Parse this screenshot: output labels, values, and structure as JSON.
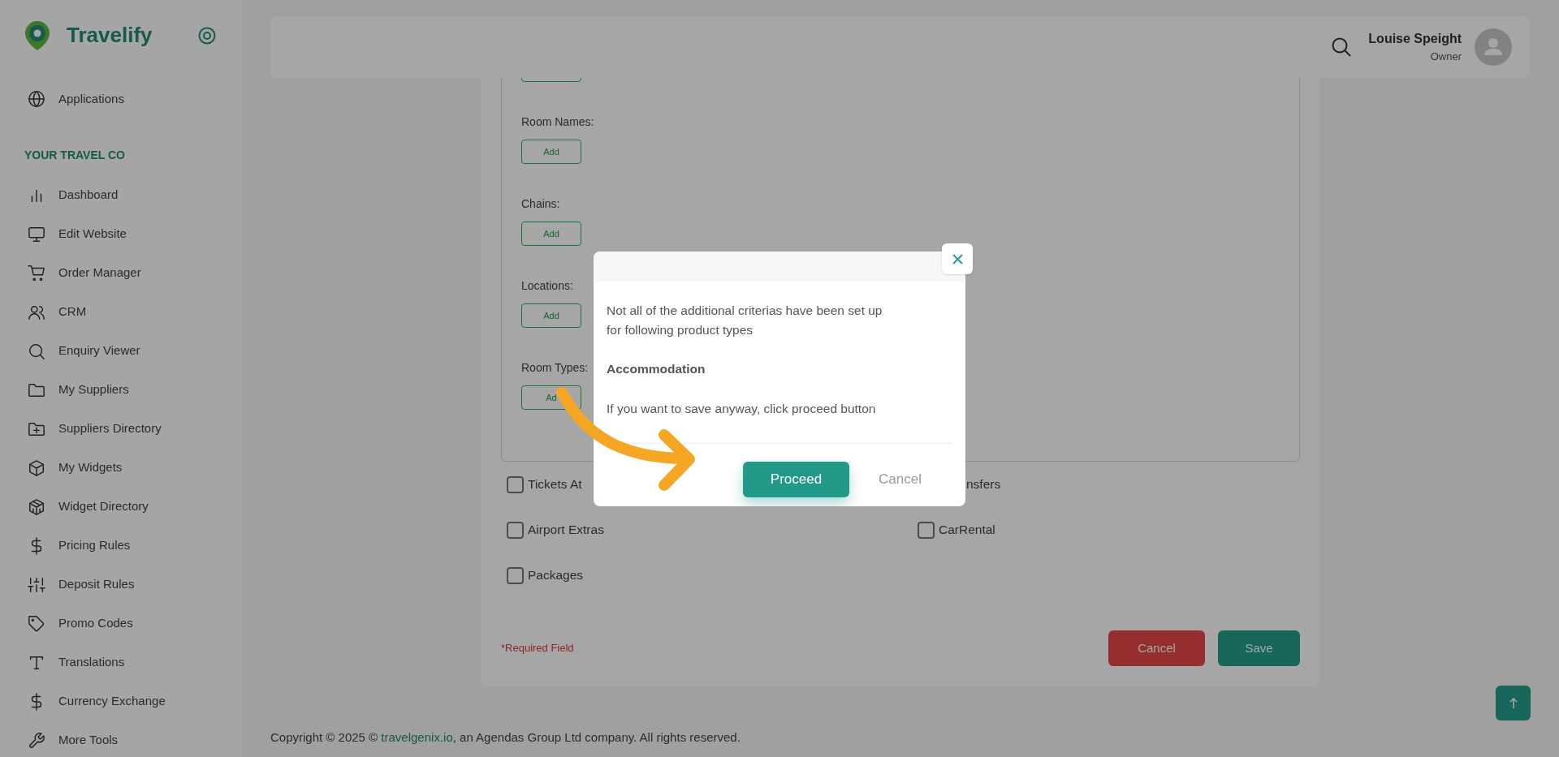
{
  "sidebar": {
    "brand": "Travelify",
    "applications": "Applications",
    "section_title": "YOUR TRAVEL CO",
    "items": [
      {
        "label": "Dashboard"
      },
      {
        "label": "Edit Website"
      },
      {
        "label": "Order Manager"
      },
      {
        "label": "CRM"
      },
      {
        "label": "Enquiry Viewer"
      },
      {
        "label": "My Suppliers"
      },
      {
        "label": "Suppliers Directory"
      },
      {
        "label": "My Widgets"
      },
      {
        "label": "Widget Directory"
      },
      {
        "label": "Pricing Rules"
      },
      {
        "label": "Deposit Rules"
      },
      {
        "label": "Promo Codes"
      },
      {
        "label": "Translations"
      },
      {
        "label": "Currency Exchange"
      },
      {
        "label": "More Tools"
      }
    ]
  },
  "header": {
    "user_name": "Louise Speight",
    "user_role": "Owner"
  },
  "form": {
    "criteria": [
      {
        "label": "Room Names:",
        "button": "Add"
      },
      {
        "label": "Chains:",
        "button": "Add"
      },
      {
        "label": "Locations:",
        "button": "Add"
      },
      {
        "label": "Room Types:",
        "button": "Ad"
      }
    ],
    "product_types": [
      {
        "label": "Tickets At",
        "checked": false,
        "kind": "full"
      },
      {
        "label": "nsfers",
        "kind": "covered"
      },
      {
        "label": "Airport Extras",
        "checked": false,
        "kind": "full"
      },
      {
        "label": "CarRental",
        "checked": false,
        "kind": "full"
      },
      {
        "label": "Packages",
        "checked": false,
        "kind": "full"
      }
    ],
    "required_note": "*Required Field",
    "cancel": "Cancel",
    "save": "Save"
  },
  "footer": {
    "prefix": "Copyright © 2025 © ",
    "link": "travelgenix.io",
    "suffix": ", an Agendas Group Ltd company. All rights reserved."
  },
  "modal": {
    "message": "Not all of the additional criterias have been set up for following product types",
    "product_type": "Accommodation",
    "hint": "If you want to save anyway, click proceed button",
    "proceed": "Proceed",
    "cancel": "Cancel"
  }
}
